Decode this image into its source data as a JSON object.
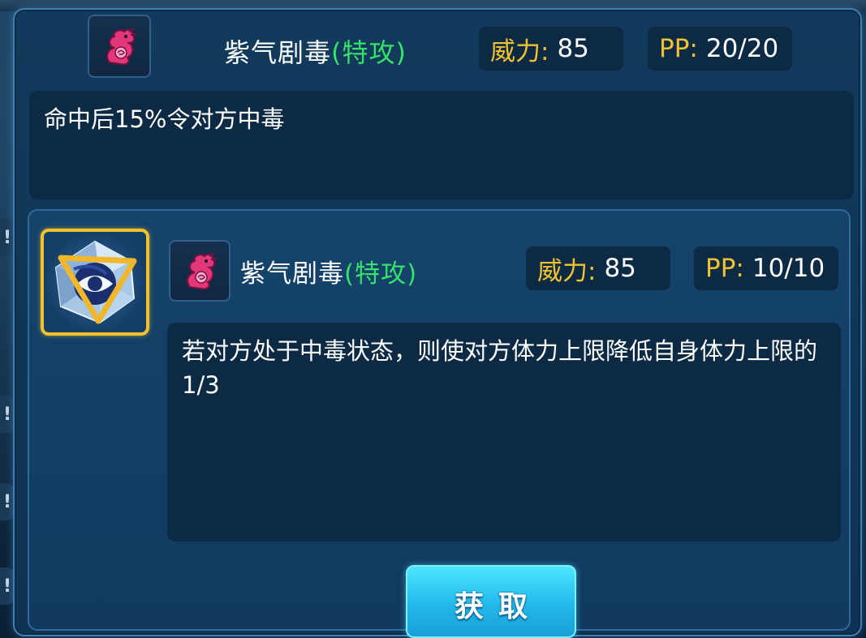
{
  "current_skill": {
    "name": "紫气剧毒",
    "category": "(特攻)",
    "power_label": "威力:",
    "power_value": "85",
    "pp_label": "PP:",
    "pp_value": "20/20",
    "description": "命中后15%令对方中毒",
    "type_icon": "poison-dragon-icon"
  },
  "new_skill": {
    "item_icon": "skill-stone-icon",
    "name": "紫气剧毒",
    "category": "(特攻)",
    "power_label": "威力:",
    "power_value": "85",
    "pp_label": "PP:",
    "pp_value": "10/10",
    "description": "若对方处于中毒状态，则使对方体力上限降低自身体力上限的1/3",
    "type_icon": "poison-dragon-icon"
  },
  "actions": {
    "get_label": "获取"
  },
  "side_marks": [
    "!",
    "!",
    "!",
    "!"
  ],
  "colors": {
    "category_green": "#36e06a",
    "stat_label_gold": "#f2c230",
    "panel_blue": "#123a5c",
    "button_cyan": "#23b8ea",
    "item_frame_gold": "#f2c12e"
  }
}
